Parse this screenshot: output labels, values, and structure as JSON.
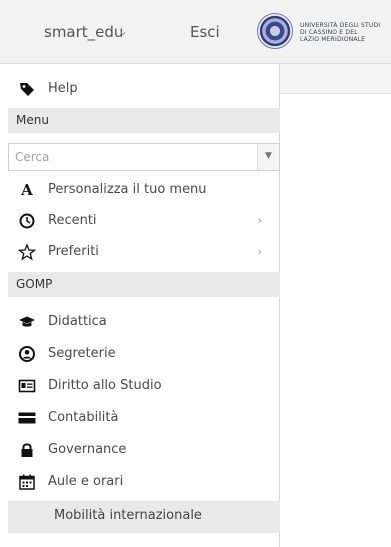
{
  "header": {
    "user_label": "smart_edu",
    "caret": "⌄",
    "logout_label": "Esci",
    "university_logo_text": "UNIVERSITÀ DEGLI STUDI DI CASSINO E DEL LAZIO MERIDIONALE"
  },
  "menu": {
    "help_label": "Help",
    "section_menu": "Menu",
    "search_placeholder": "Cerca",
    "personalize_label": "Personalizza il tuo menu",
    "recent_label": "Recenti",
    "favorites_label": "Preferiti",
    "submenu_arrow": "›",
    "section_gomp": "GOMP",
    "items": [
      {
        "label": "Didattica",
        "icon": "graduation-cap-icon"
      },
      {
        "label": "Segreterie",
        "icon": "user-circle-icon"
      },
      {
        "label": "Diritto allo Studio",
        "icon": "id-card-icon"
      },
      {
        "label": "Contabilità",
        "icon": "credit-card-icon"
      },
      {
        "label": "Governance",
        "icon": "lock-icon"
      },
      {
        "label": "Aule e orari",
        "icon": "calendar-icon"
      },
      {
        "label": "Mobilità internazionale",
        "icon": ""
      }
    ]
  }
}
